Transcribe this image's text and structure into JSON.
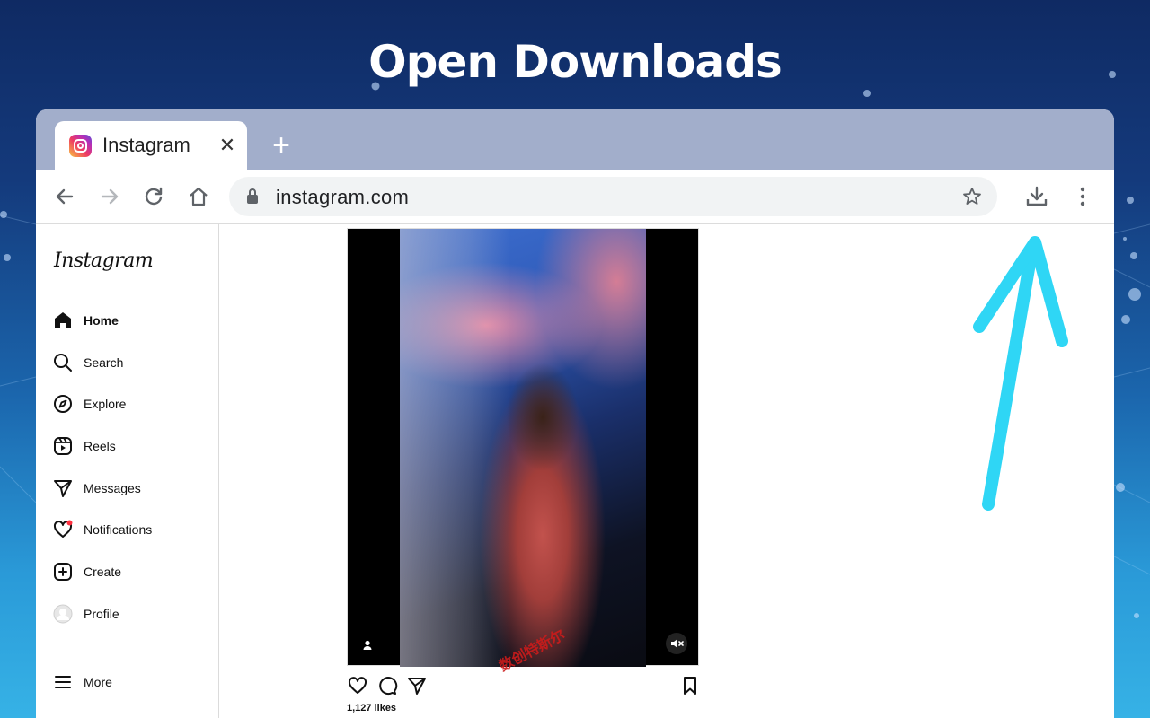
{
  "headline": "Open Downloads",
  "browser": {
    "tab": {
      "title": "Instagram",
      "favicon": "instagram-icon",
      "close_glyph": "✕"
    },
    "new_tab_glyph": "+",
    "address": {
      "url": "instagram.com"
    }
  },
  "sidebar": {
    "logo": "Instagram",
    "items": [
      {
        "label": "Home",
        "icon": "home-icon"
      },
      {
        "label": "Search",
        "icon": "search-icon"
      },
      {
        "label": "Explore",
        "icon": "compass-icon"
      },
      {
        "label": "Reels",
        "icon": "reels-icon"
      },
      {
        "label": "Messages",
        "icon": "send-icon"
      },
      {
        "label": "Notifications",
        "icon": "heart-icon"
      },
      {
        "label": "Create",
        "icon": "plus-square-icon"
      },
      {
        "label": "Profile",
        "icon": "avatar"
      },
      {
        "label": "More",
        "icon": "menu-icon"
      }
    ]
  },
  "post": {
    "likes": "1,127 likes"
  },
  "watermark": "数创特斯尔",
  "colors": {
    "accent_arrow": "#2fd6f5",
    "tabstrip": "#a2aecb",
    "notification_dot": "#ff3040"
  }
}
